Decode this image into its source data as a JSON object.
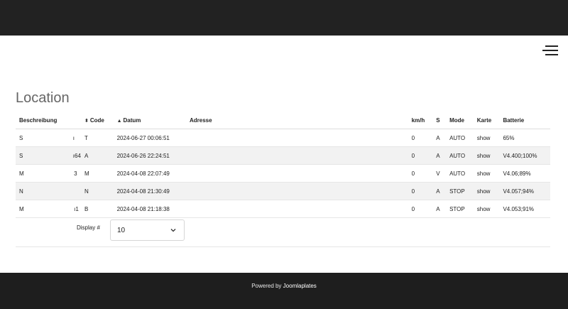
{
  "page": {
    "title": "Location"
  },
  "table": {
    "columns": {
      "beschreibung": "Beschreibung",
      "code": "Code",
      "datum": "Datum",
      "adresse": "Adresse",
      "kmh": "km/h",
      "s": "S",
      "mode": "Mode",
      "karte": "Karte",
      "batterie": "Batterie"
    },
    "rows": [
      {
        "beschreibung": "S                                            ı",
        "code": "T",
        "datum": "2024-06-27 00:06:51",
        "adresse": "",
        "kmh": "0",
        "s": "A",
        "mode": "AUTO",
        "karte": "show",
        "batterie": "65%"
      },
      {
        "beschreibung": "S                                            ı64",
        "code": "A",
        "datum": "2024-06-26 22:24:51",
        "adresse": "",
        "kmh": "0",
        "s": "A",
        "mode": "AUTO",
        "karte": "show",
        "batterie": "V4.400;100%"
      },
      {
        "beschreibung": "M                                            3",
        "code": "M",
        "datum": "2024-04-08 22:07:49",
        "adresse": "",
        "kmh": "0",
        "s": "V",
        "mode": "AUTO",
        "karte": "show",
        "batterie": "V4.06;89%"
      },
      {
        "beschreibung": "N",
        "code": "N",
        "datum": "2024-04-08 21:30:49",
        "adresse": "",
        "kmh": "0",
        "s": "A",
        "mode": "STOP",
        "karte": "show",
        "batterie": "V4.057;94%"
      },
      {
        "beschreibung": "M                                            ı1",
        "code": "B",
        "datum": "2024-04-08 21:18:38",
        "adresse": "",
        "kmh": "0",
        "s": "A",
        "mode": "STOP",
        "karte": "show",
        "batterie": "V4.053;91%"
      }
    ]
  },
  "display": {
    "label": "Display #",
    "value": "10"
  },
  "footer": {
    "prefix": "Powered by",
    "link": "Joomlaplates"
  },
  "icons": {
    "menu": "hamburger-menu-icon",
    "select": "chevron-down-icon",
    "sort": "sort-icon"
  },
  "colors": {
    "topbar": "#222222",
    "footer": "#1e1e1e",
    "title": "#666666",
    "zebra": "#f2f2f2"
  }
}
